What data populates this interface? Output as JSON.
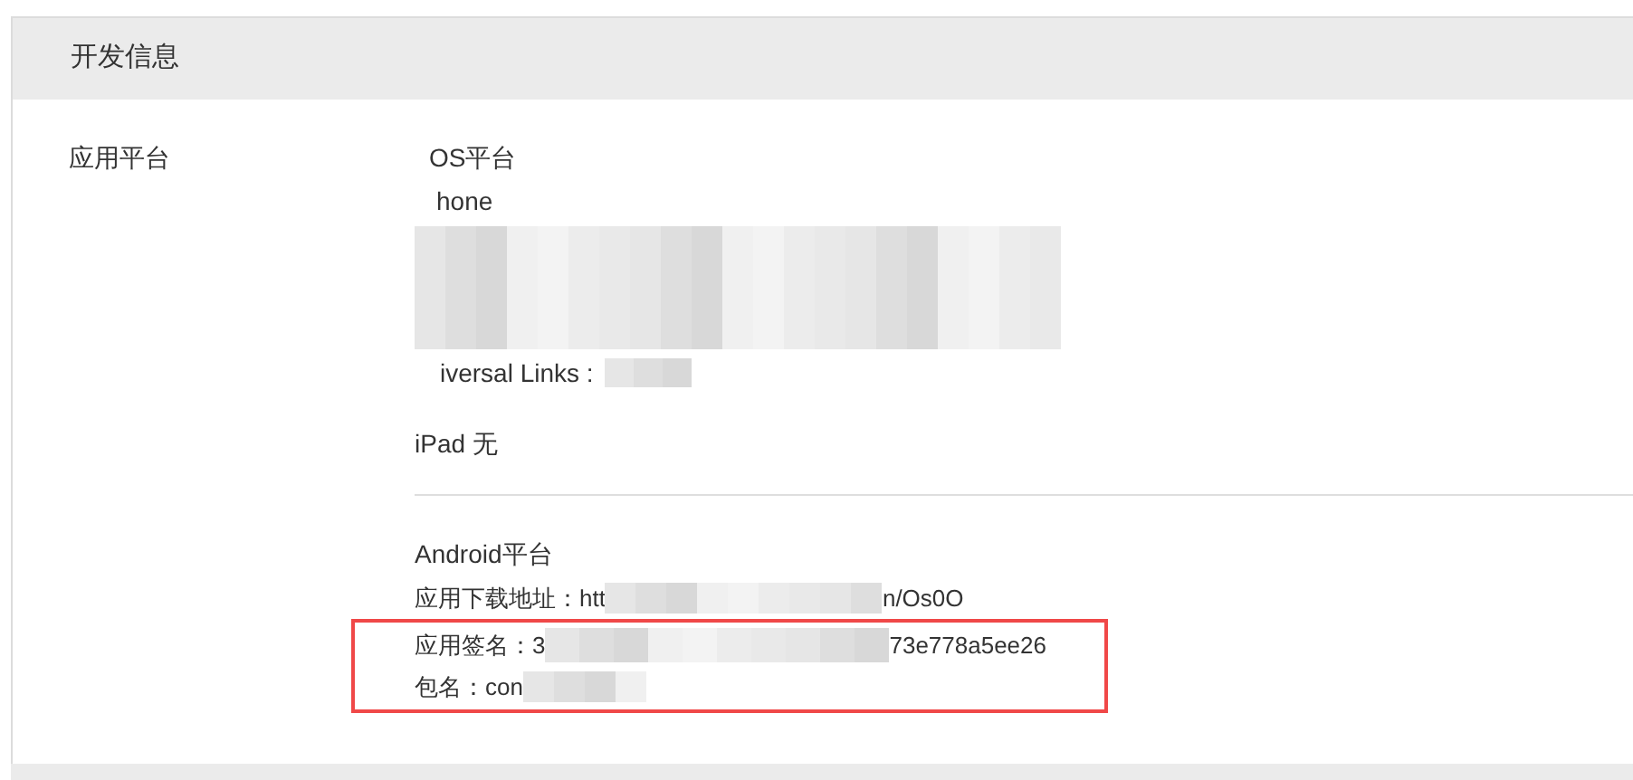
{
  "section_title": "开发信息",
  "field_label": "应用平台",
  "ios_lines": [
    "OS平台",
    "hone",
    "iversal Links :"
  ],
  "ipad_line": "iPad 无",
  "android_title": "Android平台",
  "android_lines": [
    {
      "before": "应用下载地址：htt",
      "after": "n/Os0O",
      "highlighted": false
    },
    {
      "before": "应用签名：3",
      "after": "73e778a5ee26",
      "highlighted": true
    },
    {
      "before": "包名：con",
      "highlighted": true
    }
  ]
}
